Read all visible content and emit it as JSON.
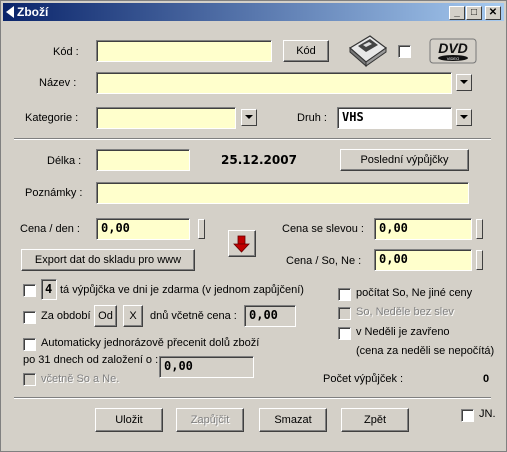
{
  "window": {
    "title": "Zboží",
    "min": "_",
    "max": "□",
    "close": "✕"
  },
  "kod": {
    "label": "Kód :",
    "value": "",
    "button": "Kód"
  },
  "nazev": {
    "label": "Název :",
    "value": ""
  },
  "kategorie": {
    "label": "Kategorie :",
    "value": ""
  },
  "druh": {
    "label": "Druh :",
    "value": "VHS"
  },
  "dvd_logo": {
    "text": "DVD",
    "sub": "VIDEO"
  },
  "delka": {
    "label": "Délka :",
    "value": "",
    "date": "25.12.2007",
    "last_button": "Poslední výpůjčky"
  },
  "poznamky": {
    "label": "Poznámky :",
    "value": ""
  },
  "cena_den": {
    "label": "Cena / den :",
    "value": "0,00"
  },
  "cena_sleva": {
    "label": "Cena se slevou :",
    "value": "0,00"
  },
  "cena_sone": {
    "label": "Cena / So, Ne :",
    "value": "0,00"
  },
  "export_button": "Export dat do skladu pro www",
  "free_rental": {
    "number": "4",
    "label": "tá výpůjčka ve dni je zdarma (v jednom zapůjčení)"
  },
  "period": {
    "label": "Za období",
    "od": "Od",
    "x": "X",
    "days_label": "dnů včetně cena :",
    "value": "0,00"
  },
  "auto_reprice": {
    "label": "Automaticky jednorázově přecenit dolů zboží",
    "label2": "po 31 dnech od založení o :",
    "value": "0,00",
    "weekend": "včetně So a Ne."
  },
  "right_checks": {
    "diff_prices": "počítat So, Ne jiné ceny",
    "sunday_no_discount": "So, Neděle bez slev",
    "sunday_closed": "v Neděli je zavřeno",
    "sunday_note": "(cena za neděli se nepočítá)"
  },
  "rental_count": {
    "label": "Počet výpůjček :",
    "value": "0"
  },
  "buttons": {
    "save": "Uložit",
    "lend": "Zapůjčit",
    "delete": "Smazat",
    "back": "Zpět"
  },
  "jn": "JN."
}
